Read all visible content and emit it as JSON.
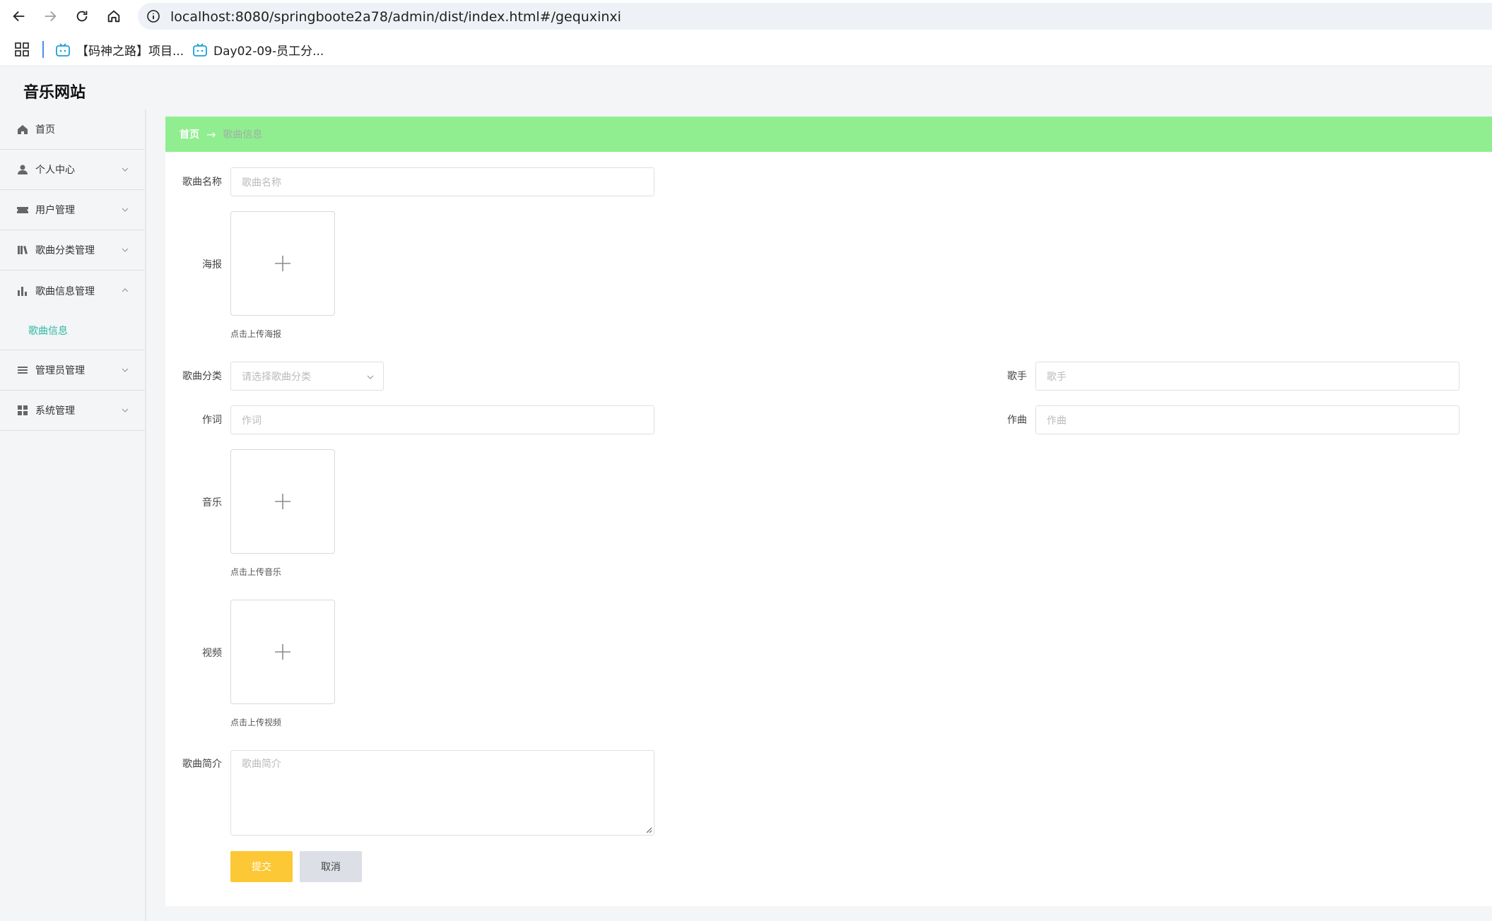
{
  "browser": {
    "url": "localhost:8080/springboote2a78/admin/dist/index.html#/gequxinxi",
    "bookmarks": [
      {
        "label": "【码神之路】项目..."
      },
      {
        "label": "Day02-09-员工分..."
      }
    ]
  },
  "app": {
    "brand": "音乐网站"
  },
  "sidebar": {
    "items": [
      {
        "label": "首页",
        "icon": "home-icon"
      },
      {
        "label": "个人中心",
        "icon": "user-icon"
      },
      {
        "label": "用户管理",
        "icon": "ticket-icon"
      },
      {
        "label": "歌曲分类管理",
        "icon": "library-icon"
      },
      {
        "label": "歌曲信息管理",
        "icon": "bar-chart-icon"
      },
      {
        "label": "管理员管理",
        "icon": "list-icon"
      },
      {
        "label": "系统管理",
        "icon": "grid-icon"
      }
    ],
    "active_sub": "歌曲信息"
  },
  "breadcrumb": {
    "home": "首页",
    "arrow": "→",
    "current": "歌曲信息"
  },
  "form": {
    "name": {
      "label": "歌曲名称",
      "placeholder": "歌曲名称"
    },
    "poster": {
      "label": "海报",
      "hint": "点击上传海报"
    },
    "category": {
      "label": "歌曲分类",
      "placeholder": "请选择歌曲分类"
    },
    "singer": {
      "label": "歌手",
      "placeholder": "歌手"
    },
    "lyricist": {
      "label": "作词",
      "placeholder": "作词"
    },
    "composer": {
      "label": "作曲",
      "placeholder": "作曲"
    },
    "music": {
      "label": "音乐",
      "hint": "点击上传音乐"
    },
    "video": {
      "label": "视频",
      "hint": "点击上传视频"
    },
    "intro": {
      "label": "歌曲简介",
      "placeholder": "歌曲简介"
    },
    "submit": "提交",
    "cancel": "取消"
  },
  "colors": {
    "breadcrumb_bg": "#90ee90",
    "submit_bg": "#fdc836",
    "active_sub": "#2fb9a2"
  }
}
